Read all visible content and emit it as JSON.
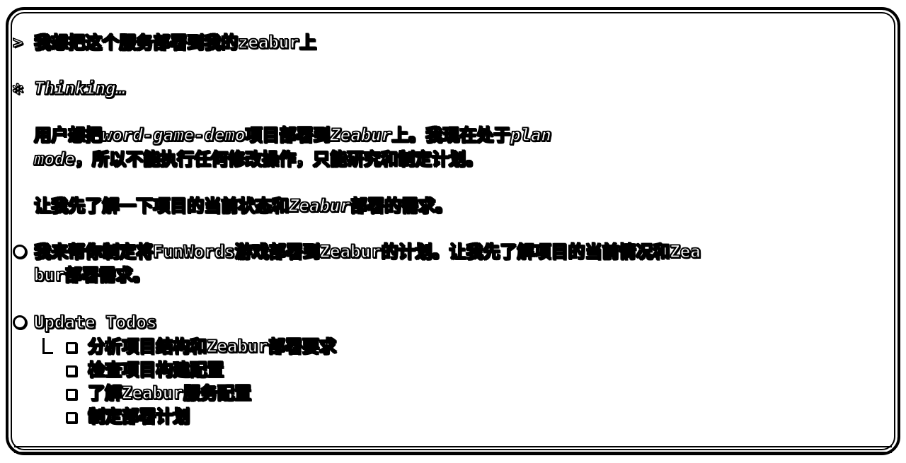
{
  "prompt": {
    "marker": ">",
    "text": "我想把这个服务部署到我的zeabur上"
  },
  "thinking": {
    "marker": "✻",
    "label": "Thinking…",
    "para1_line1_a": "用户想把",
    "para1_line1_b": "word-game-demo",
    "para1_line1_c": "项目部署到",
    "para1_line1_d": "Zeabur",
    "para1_line1_e": "上。我现在处于",
    "para1_line1_f": "plan",
    "para1_line2_a": "mode",
    "para1_line2_b": "，所以不能执行任何修改操作，只能研究和制定计划。",
    "para2_a": "让我先了解一下项目的当前状态和",
    "para2_b": "Zeabur",
    "para2_c": "部署的需求。"
  },
  "message": {
    "line1": "我来帮你制定将FunWords游戏部署到Zeabur的计划。让我先了解项目的当前情况和Zea",
    "line2": "bur部署需求。"
  },
  "todos": {
    "title": "Update Todos",
    "items": [
      {
        "label": "分析项目结构和Zeabur部署要求",
        "checked": false
      },
      {
        "label": "检查项目构建配置",
        "checked": false
      },
      {
        "label": "了解Zeabur服务配置",
        "checked": false
      },
      {
        "label": "制定部署计划",
        "checked": false
      }
    ]
  }
}
